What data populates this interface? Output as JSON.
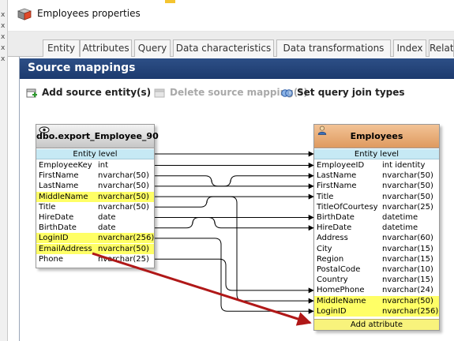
{
  "window": {
    "title": "Employees properties",
    "background_strip": [
      "x",
      "x",
      "x",
      "x",
      "x"
    ]
  },
  "tabs": [
    "Entity",
    "Attributes",
    "Query",
    "Data characteristics",
    "Data transformations",
    "Index",
    "Relati"
  ],
  "section": {
    "title": "Source mappings"
  },
  "toolbar": {
    "add_source": "Add source entity(s)",
    "delete_mapping": "Delete source mapping(s)",
    "join_types": "Set query join types"
  },
  "source_entity": {
    "title": "dbo.export_Employee_90",
    "level": "Entity level",
    "rows": [
      {
        "name": "EmployeeKey",
        "type": "int",
        "highlight": false
      },
      {
        "name": "FirstName",
        "type": "nvarchar(50)",
        "highlight": false
      },
      {
        "name": "LastName",
        "type": "nvarchar(50)",
        "highlight": false
      },
      {
        "name": "MiddleName",
        "type": "nvarchar(50)",
        "highlight": true
      },
      {
        "name": "Title",
        "type": "nvarchar(50)",
        "highlight": false
      },
      {
        "name": "HireDate",
        "type": "date",
        "highlight": false
      },
      {
        "name": "BirthDate",
        "type": "date",
        "highlight": false
      },
      {
        "name": "LoginID",
        "type": "nvarchar(256)",
        "highlight": true
      },
      {
        "name": "EmailAddress",
        "type": "nvarchar(50)",
        "highlight": true
      },
      {
        "name": "Phone",
        "type": "nvarchar(25)",
        "highlight": false
      }
    ]
  },
  "target_entity": {
    "title": "Employees",
    "level": "Entity level",
    "add_attribute": "Add attribute",
    "rows": [
      {
        "name": "EmployeeID",
        "type": "int identity",
        "highlight": false
      },
      {
        "name": "LastName",
        "type": "nvarchar(50)",
        "highlight": false
      },
      {
        "name": "FirstName",
        "type": "nvarchar(50)",
        "highlight": false
      },
      {
        "name": "Title",
        "type": "nvarchar(50)",
        "highlight": false
      },
      {
        "name": "TitleOfCourtesy",
        "type": "nvarchar(25)",
        "highlight": false
      },
      {
        "name": "BirthDate",
        "type": "datetime",
        "highlight": false
      },
      {
        "name": "HireDate",
        "type": "datetime",
        "highlight": false
      },
      {
        "name": "Address",
        "type": "nvarchar(60)",
        "highlight": false
      },
      {
        "name": "City",
        "type": "nvarchar(15)",
        "highlight": false
      },
      {
        "name": "Region",
        "type": "nvarchar(15)",
        "highlight": false
      },
      {
        "name": "PostalCode",
        "type": "nvarchar(10)",
        "highlight": false
      },
      {
        "name": "Country",
        "type": "nvarchar(15)",
        "highlight": false
      },
      {
        "name": "HomePhone",
        "type": "nvarchar(24)",
        "highlight": false
      },
      {
        "name": "MiddleName",
        "type": "nvarchar(50)",
        "highlight": true
      },
      {
        "name": "LoginID",
        "type": "nvarchar(256)",
        "highlight": true
      }
    ]
  },
  "colors": {
    "header_blue": "#1c3a6e",
    "highlight_yellow": "#ffff66",
    "entity_level": "#c6e9f4",
    "target_header": "#e8a56a",
    "annotation_arrow": "#b01818"
  }
}
